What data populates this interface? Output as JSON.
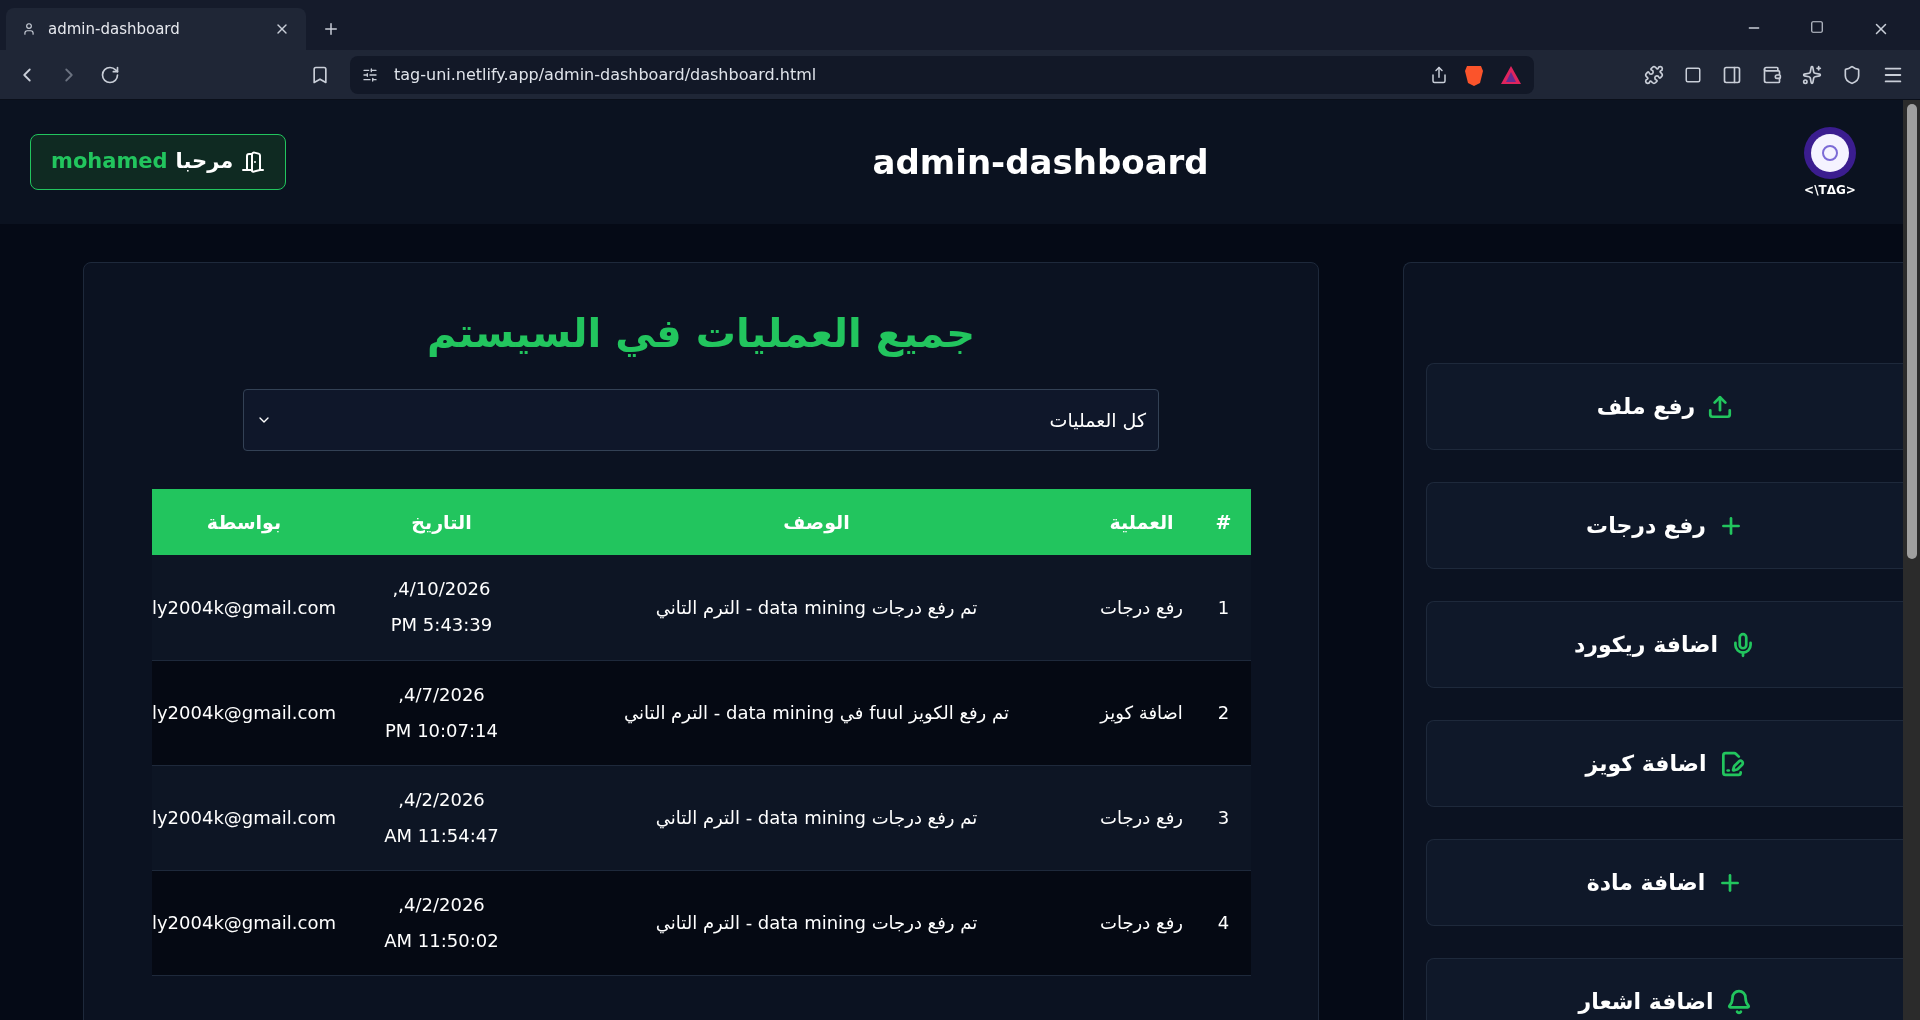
{
  "browser": {
    "tab": {
      "title": "admin-dashboard"
    },
    "url": "tag-uni.netlify.app/admin-dashboard/dashboard.html"
  },
  "header": {
    "title": "admin-dashboard",
    "logo_text": "<\\TΔG>",
    "greeting": "مرحبا",
    "user": "mohamed"
  },
  "panel": {
    "title": "جميع العمليات في السيستم",
    "filter": {
      "value": "كل العمليات"
    },
    "table": {
      "columns": [
        "#",
        "العملية",
        "الوصف",
        "التاريخ",
        "بواسطة"
      ],
      "rows": [
        {
          "num": "1",
          "operation": "رفع درجات",
          "description": "تم رفع درجات data mining - الترم التاني",
          "date": "4/10/2026, 5:43:39 PM",
          "by": "ly2004k@gmail.com"
        },
        {
          "num": "2",
          "operation": "اضافة كويز",
          "description": "تم رفع الكويز fuul في data mining - الترم التاني",
          "date": "4/7/2026, 10:07:14 PM",
          "by": "ly2004k@gmail.com"
        },
        {
          "num": "3",
          "operation": "رفع درجات",
          "description": "تم رفع درجات data mining - الترم التاني",
          "date": "4/2/2026, 11:54:47 AM",
          "by": "ly2004k@gmail.com"
        },
        {
          "num": "4",
          "operation": "رفع درجات",
          "description": "تم رفع درجات data mining - الترم التاني",
          "date": "4/2/2026, 11:50:02 AM",
          "by": "ly2004k@gmail.com"
        }
      ]
    }
  },
  "sidebar": {
    "items": [
      {
        "label": "رفع ملف",
        "kind": "upload"
      },
      {
        "label": "رفع درجات",
        "kind": "plus"
      },
      {
        "label": "اضافة ريكورد",
        "kind": "mic"
      },
      {
        "label": "اضافة كويز",
        "kind": "quiz"
      },
      {
        "label": "اضافة مادة",
        "kind": "plus"
      },
      {
        "label": "اضافة اشعار",
        "kind": "bell"
      }
    ]
  }
}
